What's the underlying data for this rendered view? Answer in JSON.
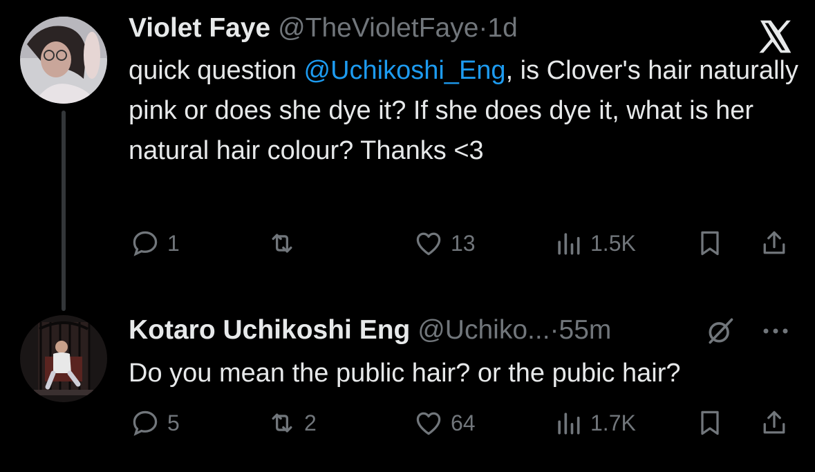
{
  "tweets": [
    {
      "display_name": "Violet Faye",
      "handle": "@TheVioletFaye",
      "separator": "·",
      "time": "1d",
      "text_before": "quick question ",
      "mention": "@Uchikoshi_Eng",
      "text_after": ", is Clover's hair naturally pink or does she dye it? If she does dye it, what is her natural hair colour? Thanks <3",
      "replies": "1",
      "retweets": "",
      "likes": "13",
      "views": "1.5K"
    },
    {
      "display_name": "Kotaro Uchikoshi Eng",
      "handle": "@Uchiko...",
      "separator": "·",
      "time": "55m",
      "text": "Do you mean the public hair? or the pubic hair?",
      "replies": "5",
      "retweets": "2",
      "likes": "64",
      "views": "1.7K"
    }
  ],
  "icons": [
    "x-logo-icon",
    "grok-icon",
    "more-icon",
    "reply-icon",
    "retweet-icon",
    "like-icon",
    "views-icon",
    "bookmark-icon",
    "share-icon"
  ],
  "colors": {
    "background": "#000000",
    "text": "#e7e9ea",
    "secondary": "#71767b",
    "link": "#1d9bf0"
  }
}
